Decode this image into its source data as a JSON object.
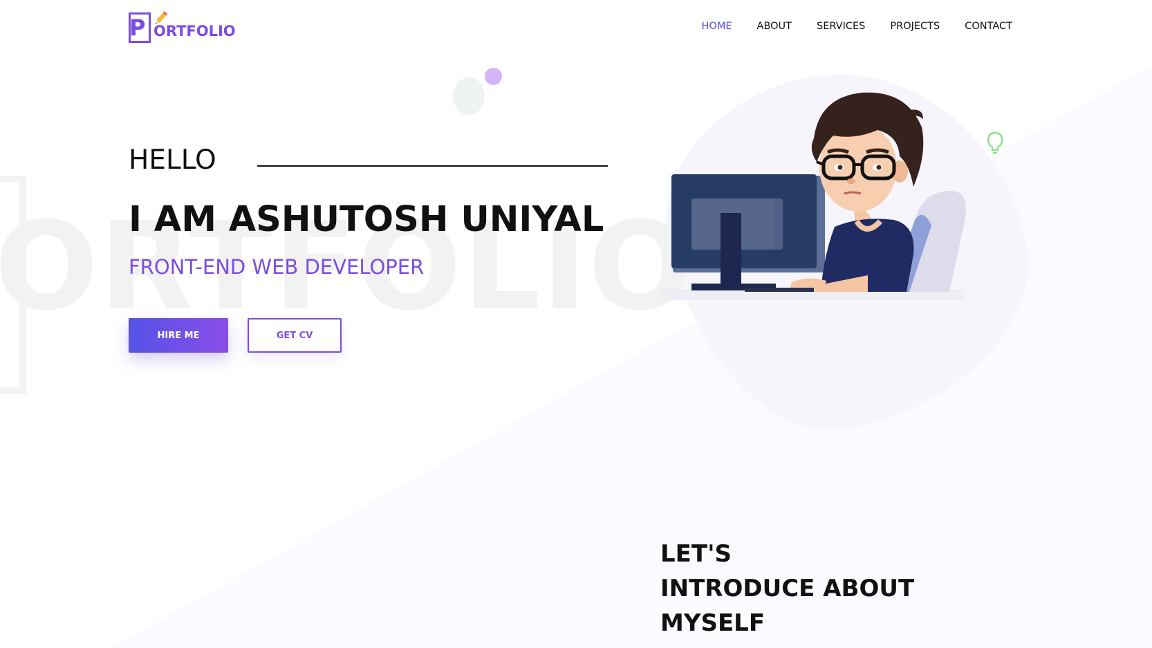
{
  "logo": {
    "initial": "P",
    "text": "ORTFOLIO"
  },
  "nav": {
    "items": [
      {
        "label": "HOME",
        "active": true
      },
      {
        "label": "ABOUT",
        "active": false
      },
      {
        "label": "SERVICES",
        "active": false
      },
      {
        "label": "PROJECTS",
        "active": false
      },
      {
        "label": "CONTACT",
        "active": false
      }
    ]
  },
  "hero": {
    "greeting": "HELLO",
    "name": "I AM ASHUTOSH UNIYAL",
    "role": "FRONT-END WEB DEVELOPER",
    "hire_label": "HIRE ME",
    "cv_label": "GET CV"
  },
  "background": {
    "watermark": "ORTFOLIO"
  },
  "intro": {
    "lines": [
      "LET'S",
      "INTRODUCE ABOUT",
      "MYSELF"
    ]
  },
  "icons": {
    "illustration": "developer-at-computer-illustration",
    "bulb": "lightbulb-icon",
    "pencil": "pencil-icon"
  },
  "colors": {
    "accent": "#7a4ee2",
    "nav_active": "#4e4ed8",
    "bulb": "#8be08a",
    "text": "#111111"
  }
}
